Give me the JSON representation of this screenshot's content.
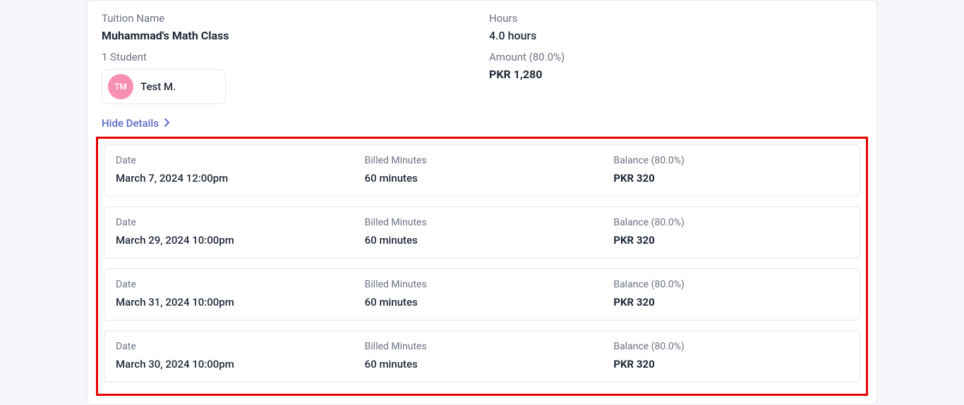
{
  "header": {
    "tuition_name_label": "Tuition Name",
    "tuition_name_value": "Muhammad's Math Class",
    "student_count_label": "1 Student",
    "hours_label": "Hours",
    "hours_value": "4.0 hours",
    "amount_label": "Amount (80.0%)",
    "amount_value": "PKR 1,280"
  },
  "student": {
    "avatar_initials": "TM",
    "name": "Test M."
  },
  "toggle": {
    "label": "Hide Details"
  },
  "details": {
    "date_label": "Date",
    "billed_label": "Billed Minutes",
    "balance_label": "Balance (80.0%)",
    "rows": [
      {
        "date": "March 7, 2024 12:00pm",
        "billed": "60 minutes",
        "balance": "PKR 320"
      },
      {
        "date": "March 29, 2024 10:00pm",
        "billed": "60 minutes",
        "balance": "PKR 320"
      },
      {
        "date": "March 31, 2024 10:00pm",
        "billed": "60 minutes",
        "balance": "PKR 320"
      },
      {
        "date": "March 30, 2024 10:00pm",
        "billed": "60 minutes",
        "balance": "PKR 320"
      }
    ]
  }
}
